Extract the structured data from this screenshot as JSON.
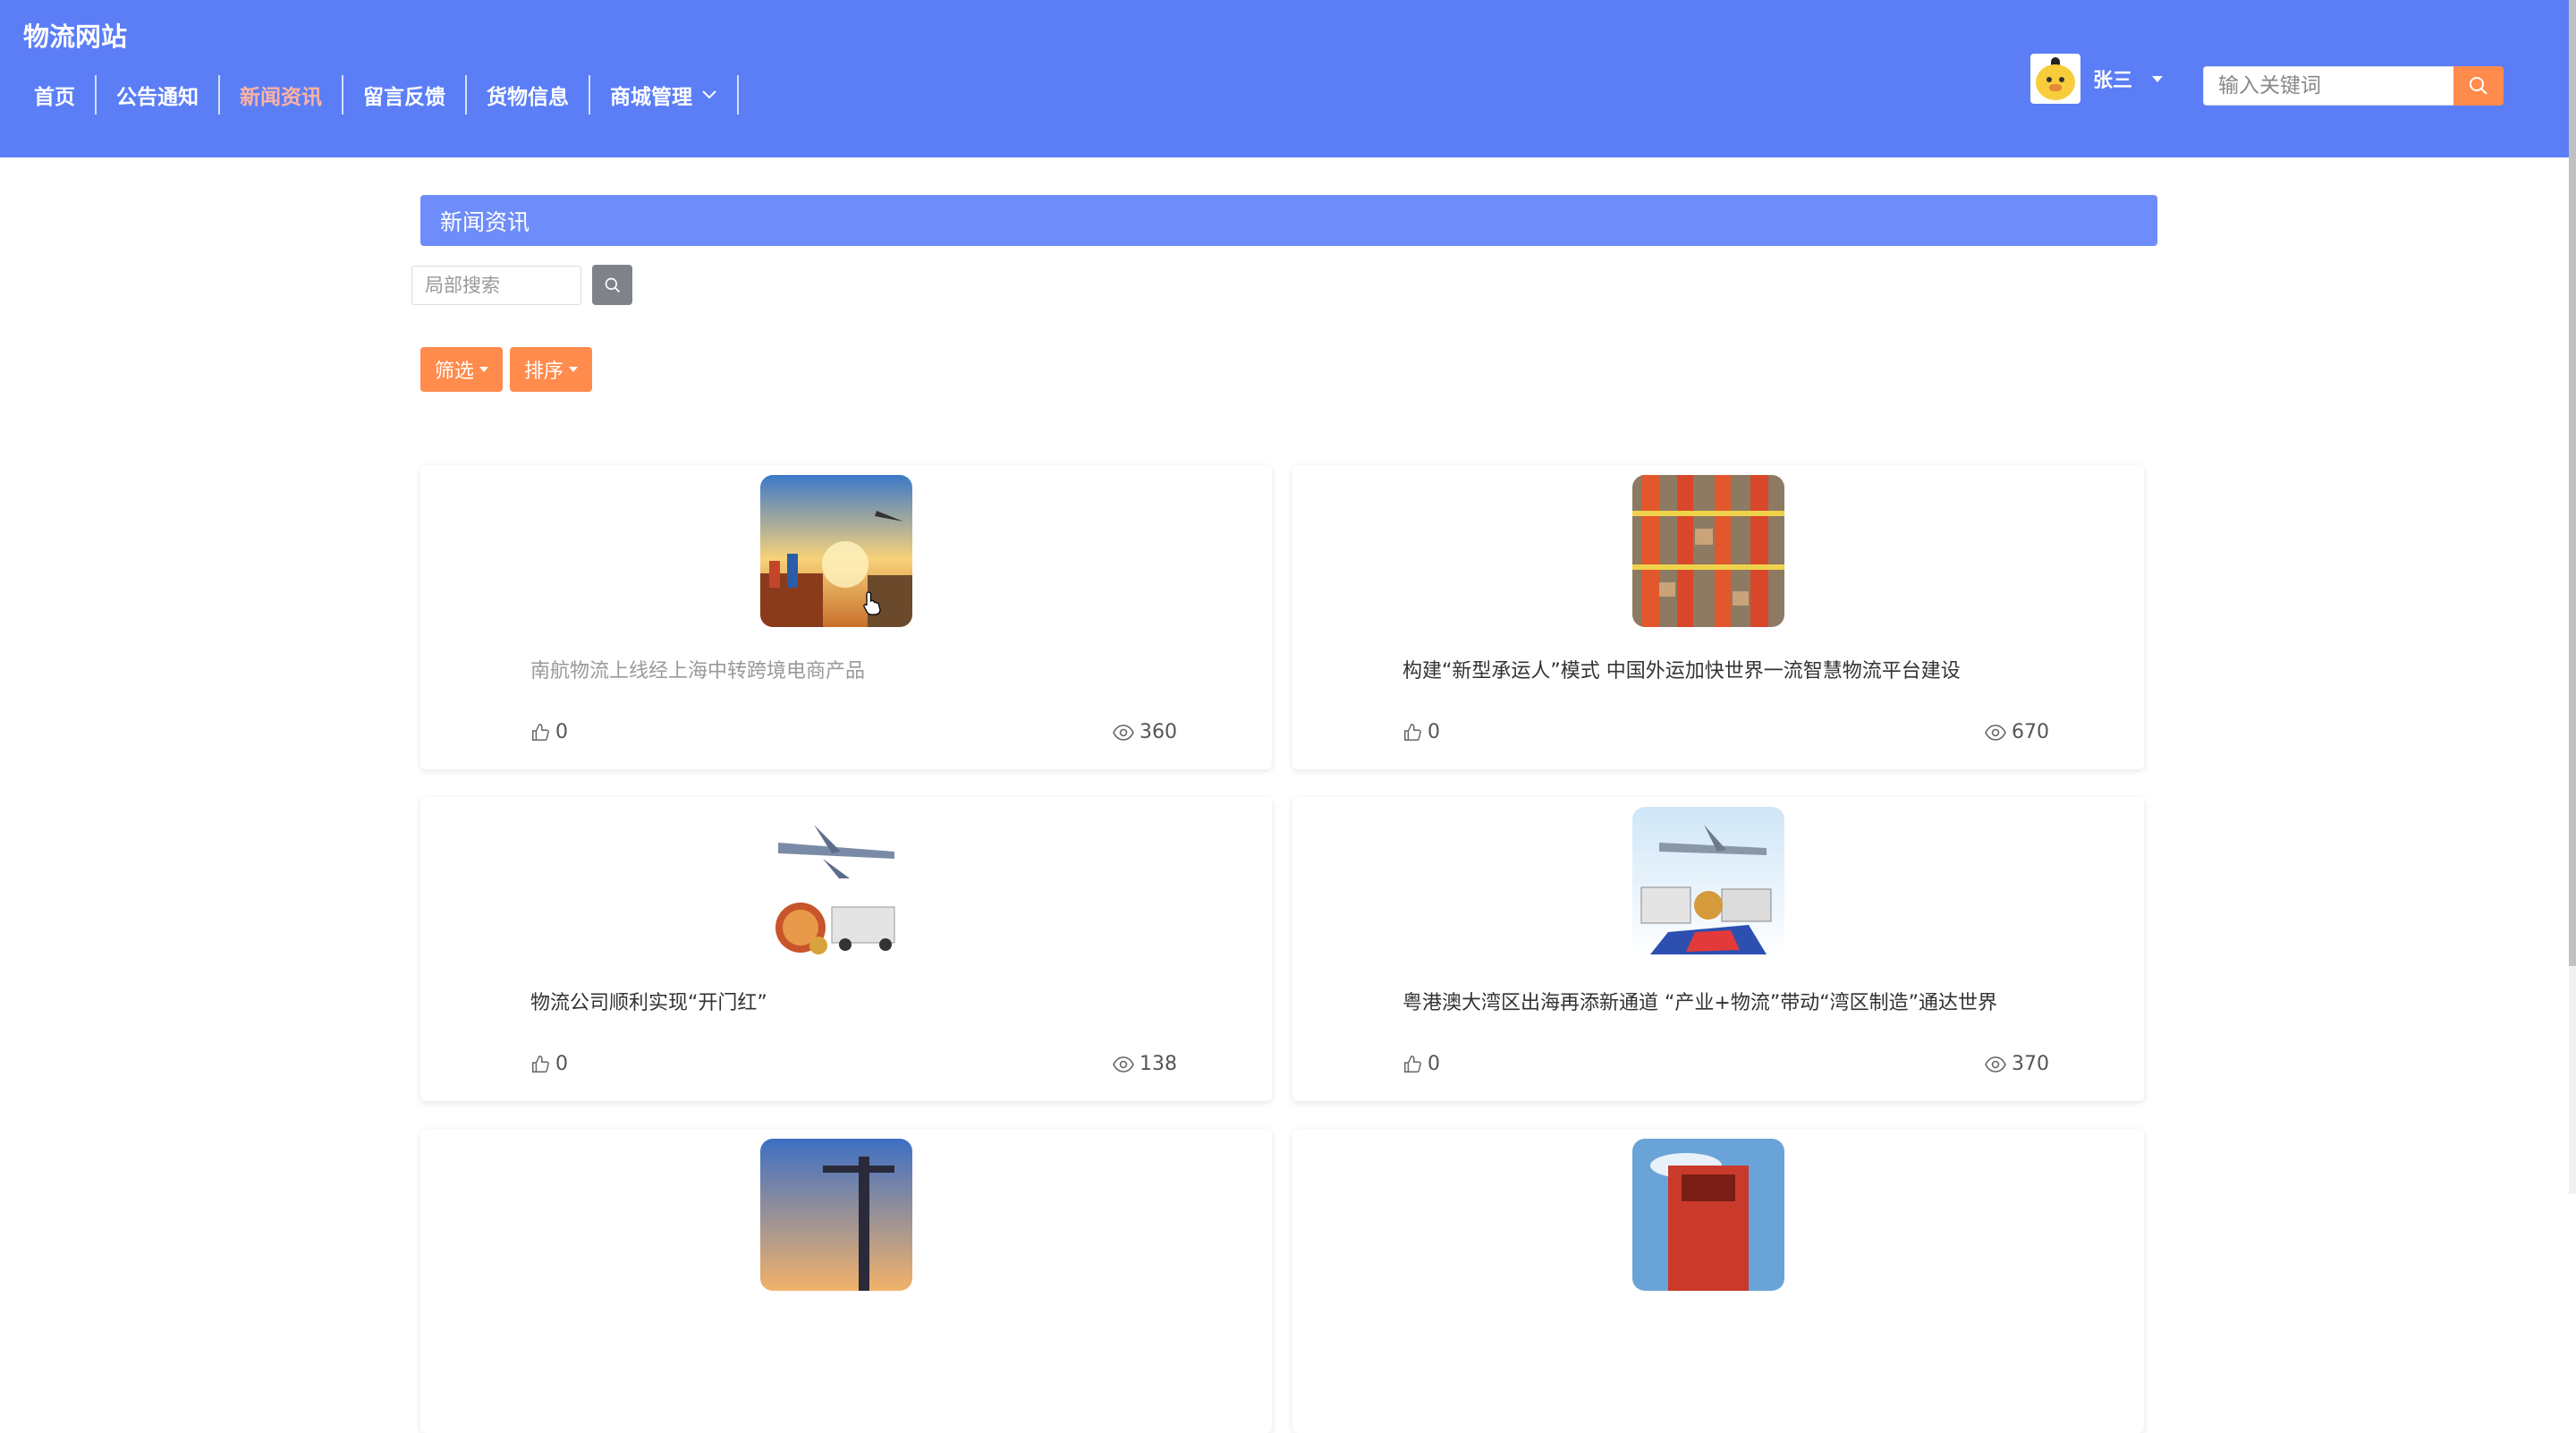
{
  "header": {
    "site_title": "物流网站",
    "nav": [
      {
        "label": "首页",
        "active": false
      },
      {
        "label": "公告通知",
        "active": false
      },
      {
        "label": "新闻资讯",
        "active": true
      },
      {
        "label": "留言反馈",
        "active": false
      },
      {
        "label": "货物信息",
        "active": false
      },
      {
        "label": "商城管理",
        "active": false,
        "has_dropdown": true
      }
    ],
    "user": {
      "name": "张三",
      "avatar": "duck-avatar-icon"
    },
    "search": {
      "placeholder": "输入关键词",
      "value": ""
    }
  },
  "page": {
    "title": "新闻资讯",
    "local_search": {
      "placeholder": "局部搜索",
      "value": ""
    },
    "filter_label": "筛选",
    "sort_label": "排序"
  },
  "news": [
    {
      "title": "南航物流上线经上海中转跨境电商产品",
      "likes": "0",
      "views": "360",
      "image": "port-plane-sunset-image"
    },
    {
      "title": "构建“新型承运人”模式 中国外运加快世界一流智慧物流平台建设",
      "likes": "0",
      "views": "670",
      "image": "warehouse-conveyor-image"
    },
    {
      "title": "物流公司顺利实现“开门红”",
      "likes": "0",
      "views": "138",
      "image": "plane-truck-globe-image"
    },
    {
      "title": "粤港澳大湾区出海再添新通道 “产业+物流”带动“湾区制造”通达世界",
      "likes": "0",
      "views": "370",
      "image": "plane-trucks-map-image"
    },
    {
      "title": "",
      "likes": "",
      "views": "",
      "image": "harbor-cranes-image"
    },
    {
      "title": "",
      "likes": "",
      "views": "",
      "image": "red-truck-image"
    }
  ],
  "colors": {
    "header_bg": "#5b7ef7",
    "title_bar_bg": "#6e8dfa",
    "accent_orange": "#ff8b4d",
    "active_nav": "#ffb3a0"
  }
}
